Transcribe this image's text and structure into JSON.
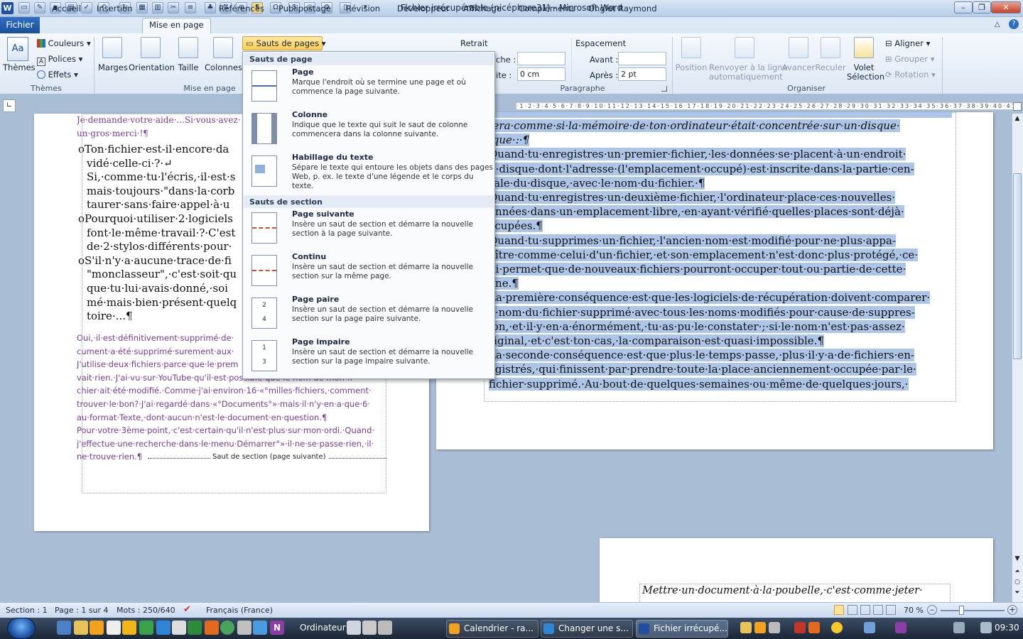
{
  "app": {
    "title": "Fichier irrécupérable (nicéphore31) - Microsoft Word"
  },
  "tabs": {
    "file": "Fichier",
    "items": [
      "Accueil",
      "Insertion",
      "Mise en page",
      "Références",
      "Publipostage",
      "Révision",
      "Développeur",
      "Affichage",
      "Compléments",
      "Onglet Raymond"
    ]
  },
  "ribbon": {
    "themes": {
      "big": "Thèmes",
      "couleurs": "Couleurs",
      "polices": "Polices",
      "effets": "Effets",
      "group": "Thèmes"
    },
    "page_setup": {
      "marges": "Marges",
      "orientation": "Orientation",
      "taille": "Taille",
      "colonnes": "Colonnes",
      "sauts": "Sauts de pages",
      "group": "Mise en page"
    },
    "paragraph": {
      "retrait": "Retrait",
      "gauche": "che :",
      "droite": "ite :",
      "droite_val": "0 cm",
      "espacement": "Espacement",
      "avant": "Avant :",
      "apres": "Après :",
      "apres_val": "2 pt",
      "group": "Paragraphe"
    },
    "arrange": {
      "position": "Position",
      "renvoyer1": "Renvoyer à la ligne",
      "renvoyer2": "automatiquement",
      "avancer": "Avancer",
      "reculer": "Reculer",
      "volet1": "Volet",
      "volet2": "Sélection",
      "aligner": "Aligner",
      "grouper": "Grouper",
      "rotation": "Rotation",
      "group": "Organiser"
    }
  },
  "menu": {
    "section1": "Sauts de page",
    "section2": "Sauts de section",
    "items": [
      {
        "title": "Page",
        "desc": "Marque l'endroit où se termine une page et où commence la page suivante."
      },
      {
        "title": "Colonne",
        "desc": "Indique que le texte qui suit le saut de colonne commencera dans la colonne suivante."
      },
      {
        "title": "Habillage du texte",
        "desc": "Sépare le texte qui entoure les objets dans des pages Web, p. ex. le texte d'une légende et le corps du texte."
      },
      {
        "title": "Page suivante",
        "desc": "Insère un saut de section et démarre la nouvelle section à la page suivante."
      },
      {
        "title": "Continu",
        "desc": "Insère un saut de section et démarre la nouvelle section sur la même page."
      },
      {
        "title": "Page paire",
        "desc": "Insère un saut de section et démarre la nouvelle section sur la page paire suivante."
      },
      {
        "title": "Page impaire",
        "desc": "Insère un saut de section et démarre la nouvelle section sur la page impaire suivante."
      }
    ]
  },
  "doc_left": {
    "top": [
      "Je·demande·votre·aide·...Si·vous·avez·",
      "un·gros·merci·!¶"
    ],
    "bullets": [
      "Ton·fichier·est-il·encore·da",
      "vidé·celle-ci·?·↵",
      "Si,·comme·tu·l'écris,·il·est·s",
      "mais·toujours·\"dans·la·corb",
      "taurer·sans·faire·appel·à·u",
      "Pourquoi·utiliser·2·logiciels",
      "font·le·même·travail·?·C'est",
      "de·2·stylos·différents·pour·",
      "S'il·n'y·a·aucune·trace·de·fi",
      "\"monclasseur\",·c'est·soit·qu",
      "que·tu·lui·avais·donné,·soi",
      "mé·mais·bien·présent·quelq",
      "toire·...¶"
    ],
    "reply": [
      "Oui,·il·est·définitivement·supprimé·de·",
      "cument·a·été·supprimé·surement·aux·",
      "J'utilise·deux·fichiers·parce·que·le·prem",
      "vait·rien.·J'ai·vu·sur·YouTube·qu'il·est·possible·que·le·nom·de·mon·fi-",
      "chier·ait·été·modifié.·Comme·j'ai·environ·16·«°milles·fichiers,·comment·",
      "trouver·le·bon?·J'ai·regardé·dans·«°Documents°»·mais·il·n'y·en·a·que·6·",
      "au·format·Texte,·dont·aucun·n'est·le·document·en·question.¶",
      "Pour·votre·3ème·point,·c'est·certain·qu'il·n'est·plus·sur·mon·ordi.·Quand·",
      "j'effectue·une·recherche·dans·le·menu·Démarrer°»·il·ne·se·passe·rien,·il·",
      "ne·trouve·rien.¶"
    ],
    "section_break": "Saut de section (page suivante)"
  },
  "doc_right": {
    "lines": [
      "fera·comme·si·la·mémoire·de·ton·ordinateur·était·concentrée·sur·un·disque·",
      "ique·:·¶",
      "Quand·tu·enregistres·un·premier·fichier,·les·données·se·placent·à·un·endroit·",
      "u·disque·dont·l'adresse·(l'emplacement·occupé)·est·inscrite·dans·la·partie·cen-",
      "rale·du·disque,·avec·le·nom·du·fichier.·¶",
      "Quand·tu·enregistres·un·deuxième·fichier,·l'ordinateur·place·ces·nouvelles·",
      "onnées·dans·un·emplacement·libre,·en·ayant·vérifié·quelles·places·sont·déjà·",
      "ccupées.¶",
      "Quand·tu·supprimes·un·fichier,·l'ancien·nom·est·modifié·pour·ne·plus·appa-",
      "aître·comme·celui·d'un·fichier,·et·son·emplacement·n'est·donc·plus·protégé,·ce·",
      "ui·permet·que·de·nouveaux·fichiers·pourront·occuper·tout·ou·partie·de·cette·",
      "one.¶",
      "La·première·conséquence·est·que·les·logiciels·de·récupération·doivent·comparer·",
      "e·nom·du·fichier·supprimé·avec·tous·les·noms·modifiés·pour·cause·de·suppres-",
      "ion,·et·il·y·en·a·énormément,·tu·as·pu·le·constater·;·si·le·nom·n'est·pas·assez·",
      "riginal,·et·c'est·ton·cas,·la·comparaison·est·quasi·impossible.¶",
      "La·seconde·conséquence·est·que·plus·le·temps·passe,·plus·il·y·a·de·fichiers·en-",
      "egistrés,·qui·finissent·par·prendre·toute·la·place·anciennement·occupée·par·le·",
      "fichier·supprimé.·Au·bout·de·quelques·semaines·ou·même·de·quelques·jours,·"
    ],
    "bottom_page": "Mettre·un·document·à·la·poubelle,·c'est·comme·jeter·"
  },
  "status": {
    "section": "Section : 1",
    "page": "Page : 1 sur 4",
    "mots": "Mots : 250/640",
    "langue": "Français (France)",
    "zoom": "70 %"
  },
  "taskbar": {
    "ordinateur": "Ordinateur",
    "items": [
      "Calendrier - ra...",
      "Changer une s...",
      "Fichier irrécupé..."
    ],
    "clock": "09:30"
  },
  "colors": {
    "selection": "#adc6e8",
    "reply_text": "#7a3a9c",
    "ribbon_accent": "#1a4f9c"
  }
}
